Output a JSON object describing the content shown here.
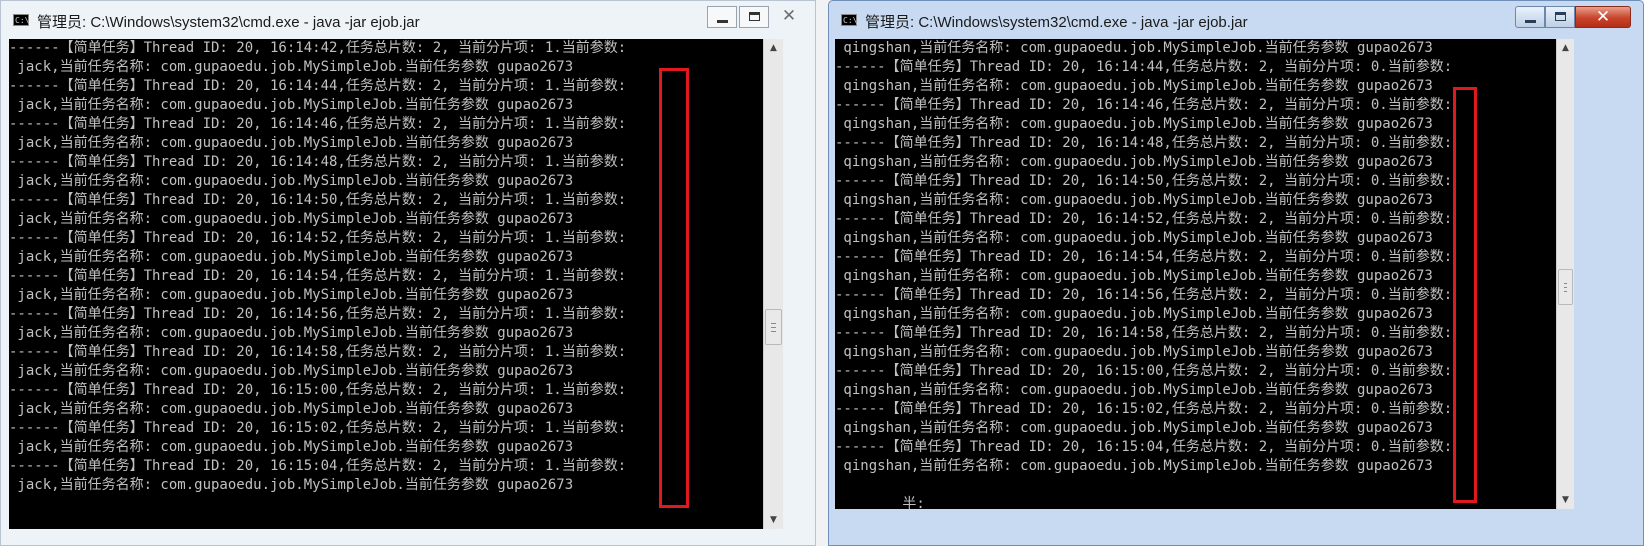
{
  "left_window": {
    "title": "管理员: C:\\Windows\\system32\\cmd.exe - java  -jar ejob.jar",
    "console_lines": [
      "------【简单任务】Thread ID: 20, 16:14:42,任务总片数: 2, 当前分片项: 1.当前参数:",
      " jack,当前任务名称: com.gupaoedu.job.MySimpleJob.当前任务参数 gupao2673",
      "------【简单任务】Thread ID: 20, 16:14:44,任务总片数: 2, 当前分片项: 1.当前参数:",
      " jack,当前任务名称: com.gupaoedu.job.MySimpleJob.当前任务参数 gupao2673",
      "------【简单任务】Thread ID: 20, 16:14:46,任务总片数: 2, 当前分片项: 1.当前参数:",
      " jack,当前任务名称: com.gupaoedu.job.MySimpleJob.当前任务参数 gupao2673",
      "------【简单任务】Thread ID: 20, 16:14:48,任务总片数: 2, 当前分片项: 1.当前参数:",
      " jack,当前任务名称: com.gupaoedu.job.MySimpleJob.当前任务参数 gupao2673",
      "------【简单任务】Thread ID: 20, 16:14:50,任务总片数: 2, 当前分片项: 1.当前参数:",
      " jack,当前任务名称: com.gupaoedu.job.MySimpleJob.当前任务参数 gupao2673",
      "------【简单任务】Thread ID: 20, 16:14:52,任务总片数: 2, 当前分片项: 1.当前参数:",
      " jack,当前任务名称: com.gupaoedu.job.MySimpleJob.当前任务参数 gupao2673",
      "------【简单任务】Thread ID: 20, 16:14:54,任务总片数: 2, 当前分片项: 1.当前参数:",
      " jack,当前任务名称: com.gupaoedu.job.MySimpleJob.当前任务参数 gupao2673",
      "------【简单任务】Thread ID: 20, 16:14:56,任务总片数: 2, 当前分片项: 1.当前参数:",
      " jack,当前任务名称: com.gupaoedu.job.MySimpleJob.当前任务参数 gupao2673",
      "------【简单任务】Thread ID: 20, 16:14:58,任务总片数: 2, 当前分片项: 1.当前参数:",
      " jack,当前任务名称: com.gupaoedu.job.MySimpleJob.当前任务参数 gupao2673",
      "------【简单任务】Thread ID: 20, 16:15:00,任务总片数: 2, 当前分片项: 1.当前参数:",
      " jack,当前任务名称: com.gupaoedu.job.MySimpleJob.当前任务参数 gupao2673",
      "------【简单任务】Thread ID: 20, 16:15:02,任务总片数: 2, 当前分片项: 1.当前参数:",
      " jack,当前任务名称: com.gupaoedu.job.MySimpleJob.当前任务参数 gupao2673",
      "------【简单任务】Thread ID: 20, 16:15:04,任务总片数: 2, 当前分片项: 1.当前参数:",
      " jack,当前任务名称: com.gupaoedu.job.MySimpleJob.当前任务参数 gupao2673"
    ]
  },
  "right_window": {
    "title": "管理员: C:\\Windows\\system32\\cmd.exe - java  -jar ejob.jar",
    "console_lines": [
      " qingshan,当前任务名称: com.gupaoedu.job.MySimpleJob.当前任务参数 gupao2673",
      "------【简单任务】Thread ID: 20, 16:14:44,任务总片数: 2, 当前分片项: 0.当前参数:",
      " qingshan,当前任务名称: com.gupaoedu.job.MySimpleJob.当前任务参数 gupao2673",
      "------【简单任务】Thread ID: 20, 16:14:46,任务总片数: 2, 当前分片项: 0.当前参数:",
      " qingshan,当前任务名称: com.gupaoedu.job.MySimpleJob.当前任务参数 gupao2673",
      "------【简单任务】Thread ID: 20, 16:14:48,任务总片数: 2, 当前分片项: 0.当前参数:",
      " qingshan,当前任务名称: com.gupaoedu.job.MySimpleJob.当前任务参数 gupao2673",
      "------【简单任务】Thread ID: 20, 16:14:50,任务总片数: 2, 当前分片项: 0.当前参数:",
      " qingshan,当前任务名称: com.gupaoedu.job.MySimpleJob.当前任务参数 gupao2673",
      "------【简单任务】Thread ID: 20, 16:14:52,任务总片数: 2, 当前分片项: 0.当前参数:",
      " qingshan,当前任务名称: com.gupaoedu.job.MySimpleJob.当前任务参数 gupao2673",
      "------【简单任务】Thread ID: 20, 16:14:54,任务总片数: 2, 当前分片项: 0.当前参数:",
      " qingshan,当前任务名称: com.gupaoedu.job.MySimpleJob.当前任务参数 gupao2673",
      "------【简单任务】Thread ID: 20, 16:14:56,任务总片数: 2, 当前分片项: 0.当前参数:",
      " qingshan,当前任务名称: com.gupaoedu.job.MySimpleJob.当前任务参数 gupao2673",
      "------【简单任务】Thread ID: 20, 16:14:58,任务总片数: 2, 当前分片项: 0.当前参数:",
      " qingshan,当前任务名称: com.gupaoedu.job.MySimpleJob.当前任务参数 gupao2673",
      "------【简单任务】Thread ID: 20, 16:15:00,任务总片数: 2, 当前分片项: 0.当前参数:",
      " qingshan,当前任务名称: com.gupaoedu.job.MySimpleJob.当前任务参数 gupao2673",
      "------【简单任务】Thread ID: 20, 16:15:02,任务总片数: 2, 当前分片项: 0.当前参数:",
      " qingshan,当前任务名称: com.gupaoedu.job.MySimpleJob.当前任务参数 gupao2673",
      "------【简单任务】Thread ID: 20, 16:15:04,任务总片数: 2, 当前分片项: 0.当前参数:",
      " qingshan,当前任务名称: com.gupaoedu.job.MySimpleJob.当前任务参数 gupao2673",
      "",
      "        半:"
    ]
  },
  "icons": {
    "app": "cmd-console-icon",
    "minimize": "minimize-icon",
    "maximize": "maximize-icon",
    "close": "close-icon",
    "scroll_up": "scroll-up-arrow-icon",
    "scroll_down": "scroll-down-arrow-icon"
  },
  "colors": {
    "console_background": "#000000",
    "console_text": "#c0c0c0",
    "highlight": "#e0191e",
    "close_button_active": "#c8442a"
  }
}
